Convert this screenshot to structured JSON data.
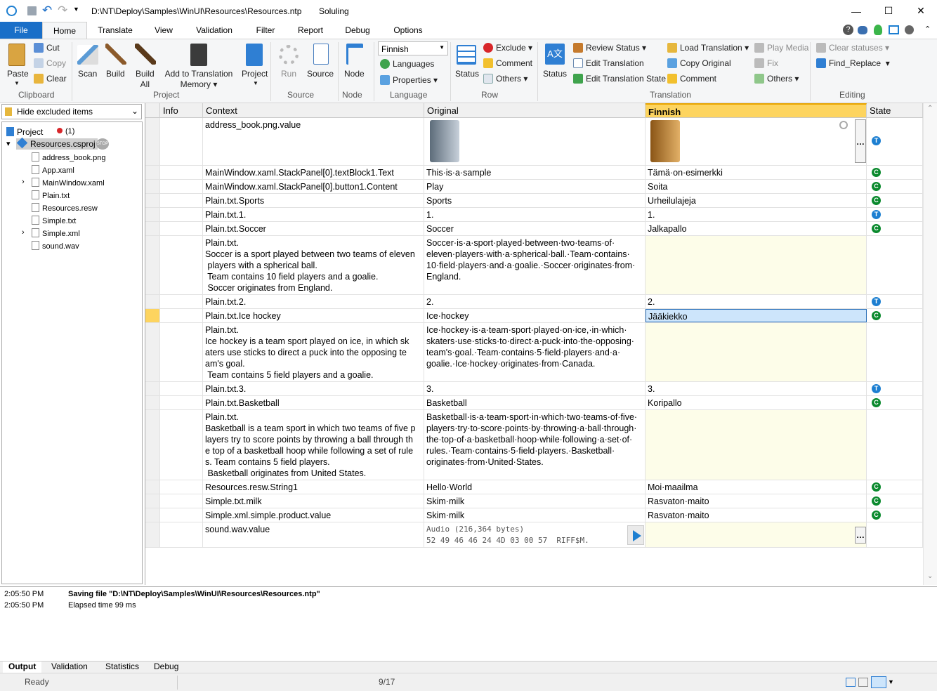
{
  "title": {
    "path": "D:\\NT\\Deploy\\Samples\\WinUI\\Resources\\Resources.ntp",
    "app": "Soluling"
  },
  "tabs": [
    "File",
    "Home",
    "Translate",
    "View",
    "Validation",
    "Filter",
    "Report",
    "Debug",
    "Options"
  ],
  "ribbon": {
    "paste": "Paste",
    "cut": "Cut",
    "copy": "Copy",
    "clear": "Clear",
    "scan": "Scan",
    "build": "Build",
    "build_all_1": "Build",
    "build_all_2": "All",
    "add_tm_1": "Add to Translation",
    "add_tm_2": "Memory",
    "project": "Project",
    "run": "Run",
    "source": "Source",
    "node": "Node",
    "language_select": "Finnish",
    "languages": "Languages",
    "properties": "Properties",
    "status": "Status",
    "exclude": "Exclude",
    "comment": "Comment",
    "others": "Others",
    "status2": "Status",
    "review_status": "Review Status",
    "edit_translation": "Edit Translation",
    "edit_translation_state": "Edit Translation State",
    "load_translation": "Load Translation",
    "copy_original": "Copy Original",
    "comment2": "Comment",
    "play_media": "Play Media",
    "fix": "Fix",
    "others2": "Others",
    "clear_statuses": "Clear statuses",
    "find_replace": "Find_Replace",
    "groups": {
      "clipboard": "Clipboard",
      "project": "Project",
      "source": "Source",
      "node": "Node",
      "language": "Language",
      "row": "Row",
      "translation": "Translation",
      "editing": "Editing"
    }
  },
  "filter": "Hide excluded items",
  "tree": {
    "root": "Project",
    "root_badge": "(1)",
    "proj": "Resources.csproj",
    "items": [
      "address_book.png",
      "App.xaml",
      "MainWindow.xaml",
      "Plain.txt",
      "Resources.resw",
      "Simple.txt",
      "Simple.xml",
      "sound.wav"
    ]
  },
  "grid": {
    "headers": [
      "Info",
      "Context",
      "Original",
      "Finnish",
      "State"
    ],
    "rows": [
      {
        "ctx": "address_book.png.value",
        "orig": "",
        "tr": "",
        "state": "T"
      },
      {
        "ctx": "MainWindow.xaml.StackPanel[0].textBlock1.Text",
        "orig": "This·is·a·sample",
        "tr": "Tämä·on·esimerkki",
        "state": "C"
      },
      {
        "ctx": "MainWindow.xaml.StackPanel[0].button1.Content",
        "orig": "Play",
        "tr": "Soita",
        "state": "C"
      },
      {
        "ctx": "Plain.txt.Sports",
        "orig": "Sports",
        "tr": "Urheilulajeja",
        "state": "C"
      },
      {
        "ctx": "Plain.txt.1.",
        "orig": "1.",
        "tr": "1.",
        "state": "T"
      },
      {
        "ctx": "Plain.txt.Soccer",
        "orig": "Soccer",
        "tr": "Jalkapallo",
        "state": "C"
      },
      {
        "ctx": "Plain.txt.\nSoccer is a sport played between two teams of eleven\n players with a spherical ball.\n Team contains 10 field players and a goalie.\n Soccer originates from England.",
        "orig": "Soccer·is·a·sport·played·between·two·teams·of·\neleven·players·with·a·spherical·ball.·Team·contains·\n10·field·players·and·a·goalie.·Soccer·originates·from·\nEngland.",
        "tr": "",
        "state": ""
      },
      {
        "ctx": "Plain.txt.2.",
        "orig": "2.",
        "tr": "2.",
        "state": "T"
      },
      {
        "ctx": "Plain.txt.Ice hockey",
        "orig": "Ice·hockey",
        "tr": "Jääkiekko",
        "state": "C"
      },
      {
        "ctx": "Plain.txt.\nIce hockey is a team sport played on ice, in which sk\naters use sticks to direct a puck into the opposing te\nam's goal.\n Team contains 5 field players and a goalie.",
        "orig": "Ice·hockey·is·a·team·sport·played·on·ice,·in·which·\nskaters·use·sticks·to·direct·a·puck·into·the·opposing·\nteam's·goal.·Team·contains·5·field·players·and·a·\ngoalie.·Ice·hockey·originates·from·Canada.",
        "tr": "",
        "state": ""
      },
      {
        "ctx": "Plain.txt.3.",
        "orig": "3.",
        "tr": "3.",
        "state": "T"
      },
      {
        "ctx": "Plain.txt.Basketball",
        "orig": "Basketball",
        "tr": "Koripallo",
        "state": "C"
      },
      {
        "ctx": "Plain.txt.\nBasketball is a team sport in which two teams of five p\nlayers try to score points by throwing a ball through th\ne top of a basketball hoop while following a set of rule\ns. Team contains 5 field players.\n Basketball originates from United States.",
        "orig": "Basketball·is·a·team·sport·in·which·two·teams·of·five·\nplayers·try·to·score·points·by·throwing·a·ball·through·\nthe·top·of·a·basketball·hoop·while·following·a·set·of·\nrules.·Team·contains·5·field·players.·Basketball·\noriginates·from·United·States.",
        "tr": "",
        "state": ""
      },
      {
        "ctx": "Resources.resw.String1",
        "orig": "Hello·World",
        "tr": "Moi·maailma",
        "state": "C"
      },
      {
        "ctx": "Simple.txt.milk",
        "orig": "Skim·milk",
        "tr": "Rasvaton·maito",
        "state": "C"
      },
      {
        "ctx": "Simple.xml.simple.product.value",
        "orig": "Skim·milk",
        "tr": "Rasvaton·maito",
        "state": "C"
      },
      {
        "ctx": "sound.wav.value",
        "orig": "Audio (216,364 bytes)\n52 49 46 46 24 4D 03 00 57  RIFF$M.",
        "tr": "",
        "state": ""
      }
    ]
  },
  "output": {
    "lines": [
      {
        "time": "2:05:50 PM",
        "msg": "Saving file \"D:\\NT\\Deploy\\Samples\\WinUI\\Resources\\Resources.ntp\""
      },
      {
        "time": "2:05:50 PM",
        "msg": "Elapsed time 99 ms"
      }
    ]
  },
  "bottom_tabs": [
    "Output",
    "Validation",
    "Statistics",
    "Debug"
  ],
  "statusbar": {
    "left": "Ready",
    "pos": "9/17"
  }
}
